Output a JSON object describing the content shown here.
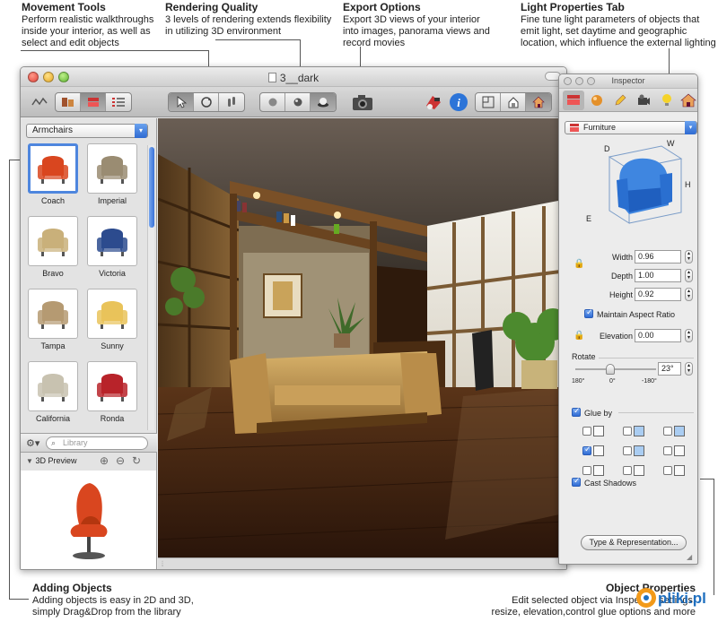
{
  "callouts": {
    "movement": {
      "title": "Movement Tools",
      "text": "Perform realistic walkthroughs inside your interior, as well as select and edit objects"
    },
    "rendering": {
      "title": "Rendering Quality",
      "text": "3 levels of rendering extends flexibility in utilizing 3D environment"
    },
    "export": {
      "title": "Export Options",
      "text": "Export 3D views of your interior into images, panorama views and record movies"
    },
    "light": {
      "title": "Light Properties Tab",
      "text": "Fine tune light parameters of objects that emit light, set daytime and geographic location, which influence the external lighting"
    },
    "adding": {
      "title": "Adding Objects",
      "text": "Adding objects is easy in 2D and 3D, simply Drag&Drop from the library"
    },
    "objprops": {
      "title": "Object Properties",
      "text": "Edit selected object via Inspector settings: resize, elevation,control glue options and more"
    }
  },
  "window": {
    "title": "3__dark"
  },
  "library": {
    "category": "Armchairs",
    "items": [
      {
        "label": "Coach",
        "color": "#d9461f",
        "selected": true
      },
      {
        "label": "Imperial",
        "color": "#9a8c72",
        "selected": false
      },
      {
        "label": "Bravo",
        "color": "#c9b07a",
        "selected": false
      },
      {
        "label": "Victoria",
        "color": "#2c4b8e",
        "selected": false
      },
      {
        "label": "Tampa",
        "color": "#b59a72",
        "selected": false
      },
      {
        "label": "Sunny",
        "color": "#e9c35a",
        "selected": false
      },
      {
        "label": "California",
        "color": "#c8c2b0",
        "selected": false
      },
      {
        "label": "Ronda",
        "color": "#b8232a",
        "selected": false
      }
    ],
    "search_placeholder": "Library",
    "preview_label": "3D Preview"
  },
  "inspector": {
    "title": "Inspector",
    "category": "Furniture",
    "dims": {
      "d": "D",
      "w": "W",
      "h": "H",
      "e": "E"
    },
    "width_label": "Width",
    "width_value": "0.96",
    "depth_label": "Depth",
    "depth_value": "1.00",
    "height_label": "Height",
    "height_value": "0.92",
    "maintain_label": "Maintain Aspect Ratio",
    "maintain_checked": true,
    "elevation_label": "Elevation",
    "elevation_value": "0.00",
    "rotate_label": "Rotate",
    "rotate_value": "23°",
    "rotate_ticks": [
      "180°",
      "0°",
      "-180°"
    ],
    "glue_label": "Glue by",
    "glue_checked": true,
    "cast_shadows_label": "Cast Shadows",
    "cast_shadows_checked": true,
    "type_button": "Type & Representation..."
  },
  "watermark": {
    "text": "pliki.pl"
  },
  "colors": {
    "accent": "#3a73d8",
    "wood": "#6b4a26"
  }
}
